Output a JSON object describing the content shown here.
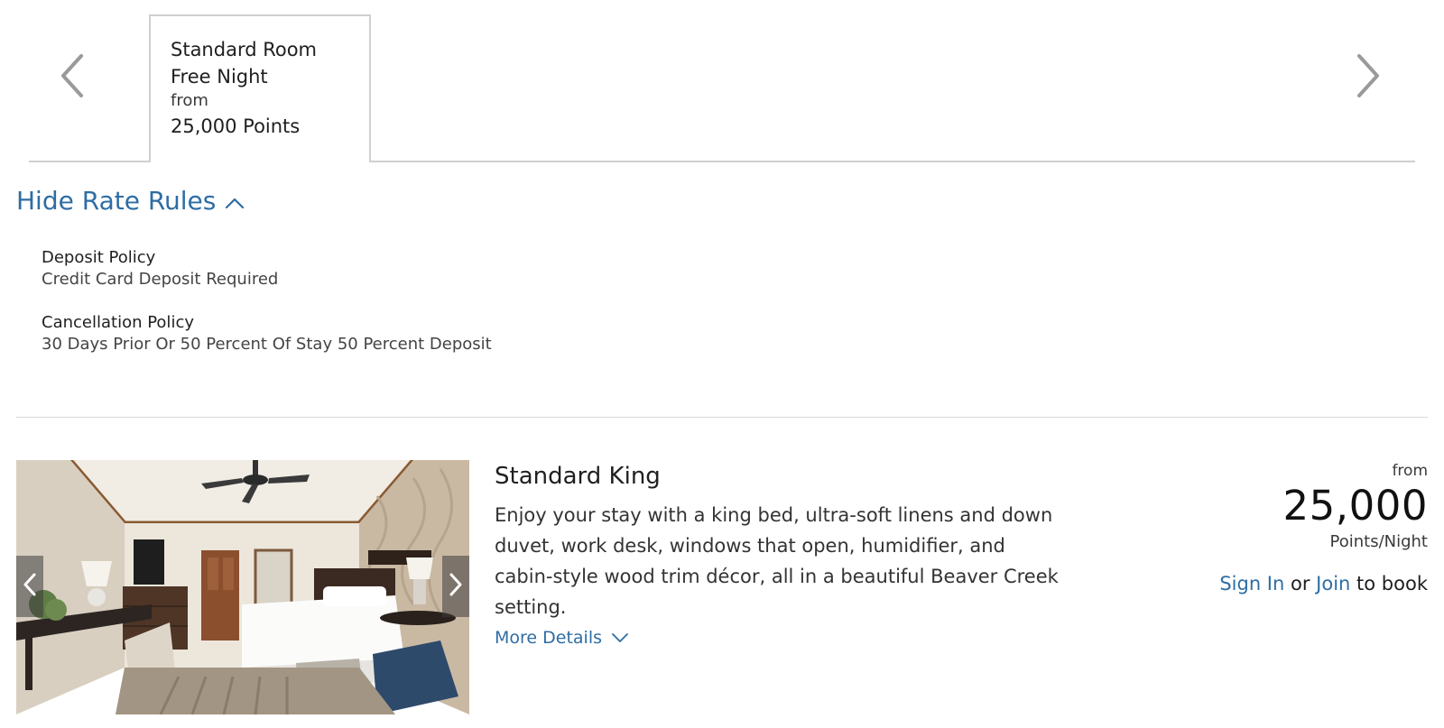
{
  "rate_tabs": {
    "items": [
      {
        "title": "Standard Room Free Night",
        "from_label": "from",
        "points": "25,000 Points",
        "selected": true
      }
    ],
    "prev_icon": "chevron-left-icon",
    "next_icon": "chevron-right-icon"
  },
  "rate_rules": {
    "toggle_label": "Hide Rate Rules",
    "toggle_icon": "chevron-up-icon",
    "rules": [
      {
        "title": "Deposit Policy",
        "value": "Credit Card Deposit Required"
      },
      {
        "title": "Cancellation Policy",
        "value": "30 Days Prior Or 50 Percent Of Stay 50 Percent Deposit"
      }
    ]
  },
  "room": {
    "name": "Standard King",
    "description": "Enjoy your stay with a king bed, ultra-soft linens and down duvet, work desk, windows that open, humidifier, and cabin-style wood trim décor, all in a beautiful Beaver Creek setting.",
    "more_details_label": "More Details",
    "more_details_icon": "chevron-down-icon",
    "image_prev_icon": "chevron-left-icon",
    "image_next_icon": "chevron-right-icon",
    "price": {
      "from_label": "from",
      "points": "25,000",
      "unit": "Points/Night"
    },
    "booking": {
      "sign_in_label": "Sign In",
      "or_text": "or",
      "join_label": "Join",
      "suffix_text": "to book"
    }
  },
  "colors": {
    "link": "#2e6da4",
    "border": "#cfcfcf",
    "text": "#1f1f1f"
  }
}
